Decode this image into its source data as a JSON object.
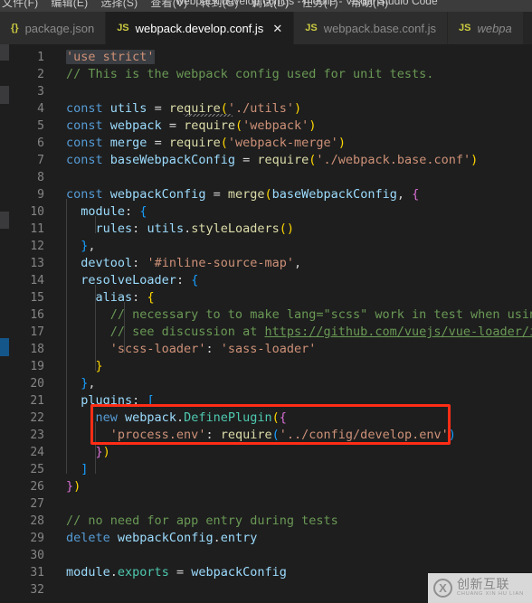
{
  "window": {
    "title": "webpack.develop.conf.js - mobile - Visual Studio Code",
    "menu": [
      "文件(F)",
      "编辑(E)",
      "选择(S)",
      "查看(V)",
      "转到(G)",
      "调试(D)",
      "任务(T)",
      "帮助(H)"
    ]
  },
  "tabs": [
    {
      "icon_label": "{}",
      "icon_name": "json-file-icon",
      "label": "package.json",
      "active": false,
      "preview": false,
      "closable": false
    },
    {
      "icon_label": "JS",
      "icon_name": "js-file-icon",
      "label": "webpack.develop.conf.js",
      "active": true,
      "preview": false,
      "closable": true,
      "close_label": "✕"
    },
    {
      "icon_label": "JS",
      "icon_name": "js-file-icon",
      "label": "webpack.base.conf.js",
      "active": false,
      "preview": false,
      "closable": false
    },
    {
      "icon_label": "JS",
      "icon_name": "js-file-icon",
      "label": "webpa",
      "active": false,
      "preview": true,
      "closable": false
    }
  ],
  "editor": {
    "language": "javascript",
    "first_line": 1,
    "last_line": 32,
    "line_numbers": [
      "1",
      "2",
      "3",
      "4",
      "5",
      "6",
      "7",
      "8",
      "9",
      "10",
      "11",
      "12",
      "13",
      "14",
      "15",
      "16",
      "17",
      "18",
      "19",
      "20",
      "21",
      "22",
      "23",
      "24",
      "25",
      "26",
      "27",
      "28",
      "29",
      "30",
      "31",
      "32"
    ],
    "lines": [
      {
        "n": 1,
        "text": "'use strict'"
      },
      {
        "n": 2,
        "text": "// This is the webpack config used for unit tests."
      },
      {
        "n": 3,
        "text": ""
      },
      {
        "n": 4,
        "text": "const utils = require('./utils')"
      },
      {
        "n": 5,
        "text": "const webpack = require('webpack')"
      },
      {
        "n": 6,
        "text": "const merge = require('webpack-merge')"
      },
      {
        "n": 7,
        "text": "const baseWebpackConfig = require('./webpack.base.conf')"
      },
      {
        "n": 8,
        "text": ""
      },
      {
        "n": 9,
        "text": "const webpackConfig = merge(baseWebpackConfig, {"
      },
      {
        "n": 10,
        "text": "  module: {"
      },
      {
        "n": 11,
        "text": "    rules: utils.styleLoaders()"
      },
      {
        "n": 12,
        "text": "  },"
      },
      {
        "n": 13,
        "text": "  devtool: '#inline-source-map',"
      },
      {
        "n": 14,
        "text": "  resolveLoader: {"
      },
      {
        "n": 15,
        "text": "    alias: {"
      },
      {
        "n": 16,
        "text": "      // necessary to to make lang=\"scss\" work in test when using v"
      },
      {
        "n": 17,
        "text": "      // see discussion at https://github.com/vuejs/vue-loader/issu"
      },
      {
        "n": 18,
        "text": "      'scss-loader': 'sass-loader'"
      },
      {
        "n": 19,
        "text": "    }"
      },
      {
        "n": 20,
        "text": "  },"
      },
      {
        "n": 21,
        "text": "  plugins: ["
      },
      {
        "n": 22,
        "text": "    new webpack.DefinePlugin({"
      },
      {
        "n": 23,
        "text": "      'process.env': require('../config/develop.env')"
      },
      {
        "n": 24,
        "text": "    })"
      },
      {
        "n": 25,
        "text": "  ]"
      },
      {
        "n": 26,
        "text": "})"
      },
      {
        "n": 27,
        "text": ""
      },
      {
        "n": 28,
        "text": "// no need for app entry during tests"
      },
      {
        "n": 29,
        "text": "delete webpackConfig.entry"
      },
      {
        "n": 30,
        "text": ""
      },
      {
        "n": 31,
        "text": "module.exports = webpackConfig"
      },
      {
        "n": 32,
        "text": ""
      }
    ]
  },
  "annotation": {
    "shape": "rectangle",
    "color": "#ff2d16",
    "covers_lines": "22-23",
    "label": ""
  },
  "watermark": {
    "logo_glyph": "X",
    "name_cn": "创新互联",
    "name_pinyin": "CHUANG XIN HU LIAN"
  },
  "colors": {
    "editor_bg": "#1e1e1e",
    "tabbar_bg": "#252526",
    "tab_inactive_bg": "#2d2d2d",
    "titlebar_bg": "#3c3c3c",
    "keyword": "#569cd6",
    "string": "#ce9178",
    "comment": "#6a9955",
    "function": "#dcdcaa",
    "property": "#9cdcfe",
    "class": "#4ec9b0",
    "linenumber": "#858585",
    "annotation": "#ff2d16"
  }
}
